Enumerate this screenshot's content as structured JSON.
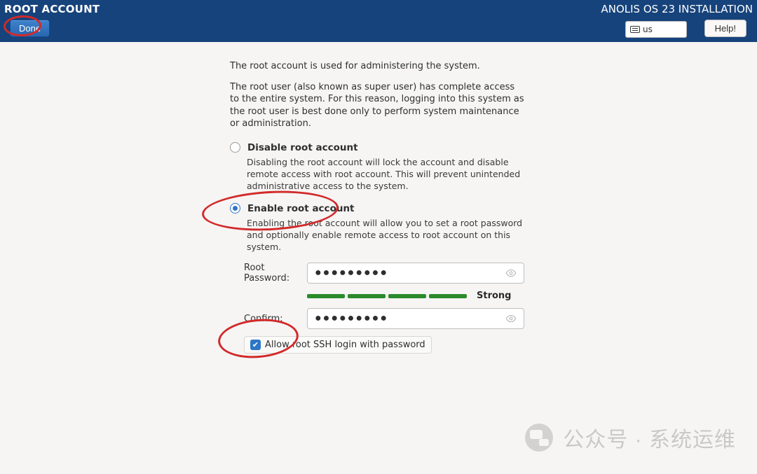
{
  "header": {
    "title": "ROOT ACCOUNT",
    "done_label": "Done",
    "distro": "ANOLIS OS 23 INSTALLATION",
    "keyboard_layout": "us",
    "help_label": "Help!"
  },
  "intro": {
    "line1": "The root account is used for administering the system.",
    "line2": "The root user (also known as super user) has complete access to the entire system. For this reason, logging into this system as the root user is best done only to perform system maintenance or administration."
  },
  "options": {
    "disable": {
      "label": "Disable root account",
      "desc": "Disabling the root account will lock the account and disable remote access with root account. This will prevent unintended administrative access to the system.",
      "selected": false
    },
    "enable": {
      "label": "Enable root account",
      "desc": "Enabling the root account will allow you to set a root password and optionally enable remote access to root account on this system.",
      "selected": true
    }
  },
  "password": {
    "root_label": "Root Password:",
    "confirm_label": "Confirm:",
    "value_masked": "●●●●●●●●●",
    "confirm_masked": "●●●●●●●●●",
    "strength_label": "Strong",
    "strength_segments": 4
  },
  "ssh": {
    "allow_label": "Allow root SSH login with password",
    "checked": true
  },
  "watermark": {
    "text": "公众号 · 系统运维"
  },
  "annotations": {
    "done_circled": true,
    "enable_circled": true,
    "ssh_circled": true
  }
}
